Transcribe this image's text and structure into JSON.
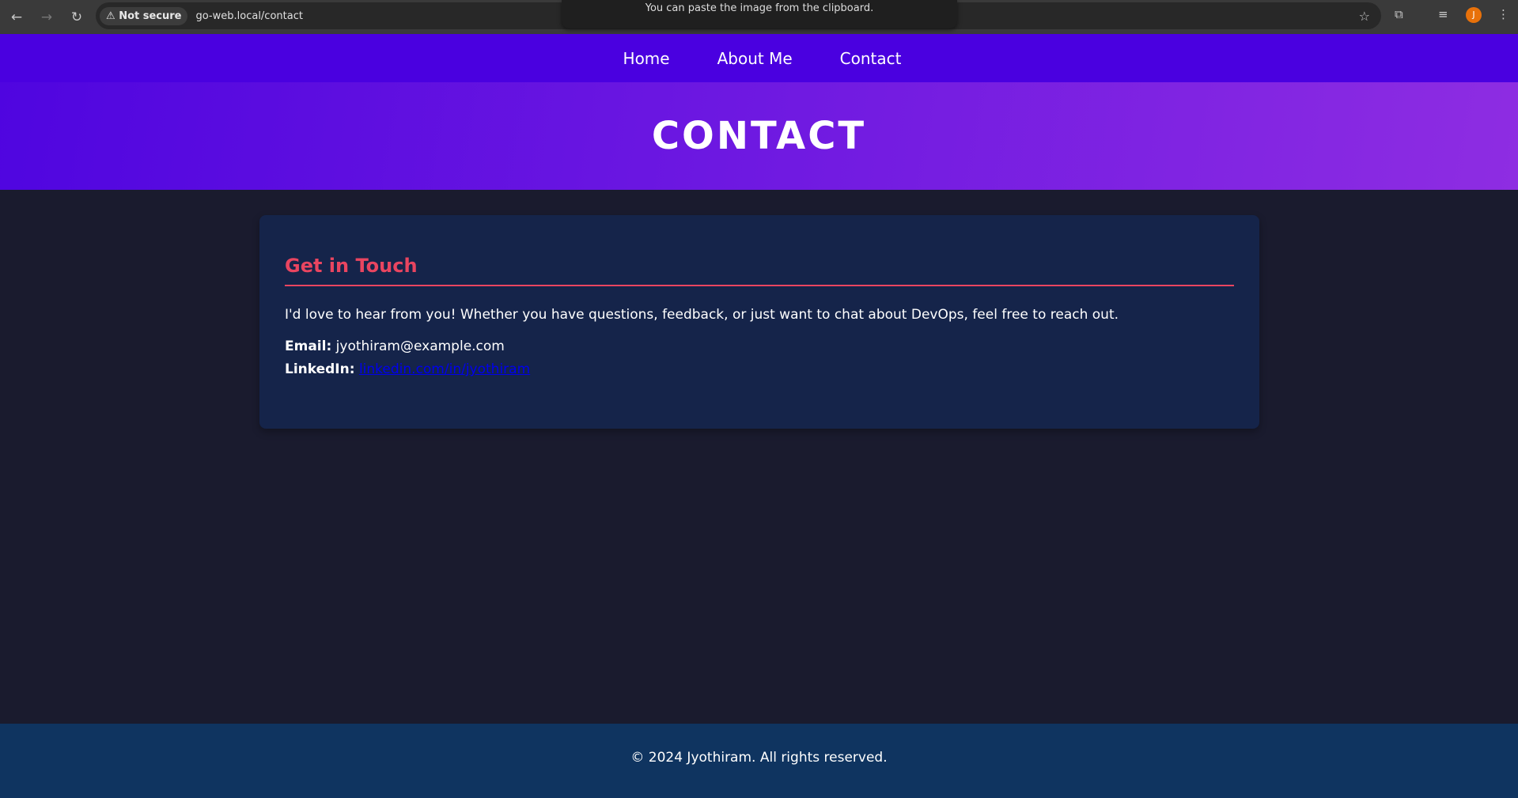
{
  "browser": {
    "security_label": "Not secure",
    "url": "go-web.local/contact",
    "toast": "You can paste the image from the clipboard.",
    "avatar_initial": "J"
  },
  "nav": {
    "items": [
      {
        "label": "Home"
      },
      {
        "label": "About Me"
      },
      {
        "label": "Contact"
      }
    ]
  },
  "hero": {
    "title": "CONTACT"
  },
  "card": {
    "heading": "Get in Touch",
    "intro": "I'd love to hear from you! Whether you have questions, feedback, or just want to chat about DevOps, feel free to reach out.",
    "email_label": "Email:",
    "email": "jyothiram@example.com",
    "linkedin_label": "LinkedIn:",
    "linkedin": "linkedin.com/in/jyothiram"
  },
  "footer": {
    "text": "© 2024 Jyothiram. All rights reserved."
  },
  "colors": {
    "nav": "#4a00e0",
    "accent": "#e94560",
    "card": "#15244a",
    "footer": "#0f3460",
    "background": "#1a1b2e"
  }
}
